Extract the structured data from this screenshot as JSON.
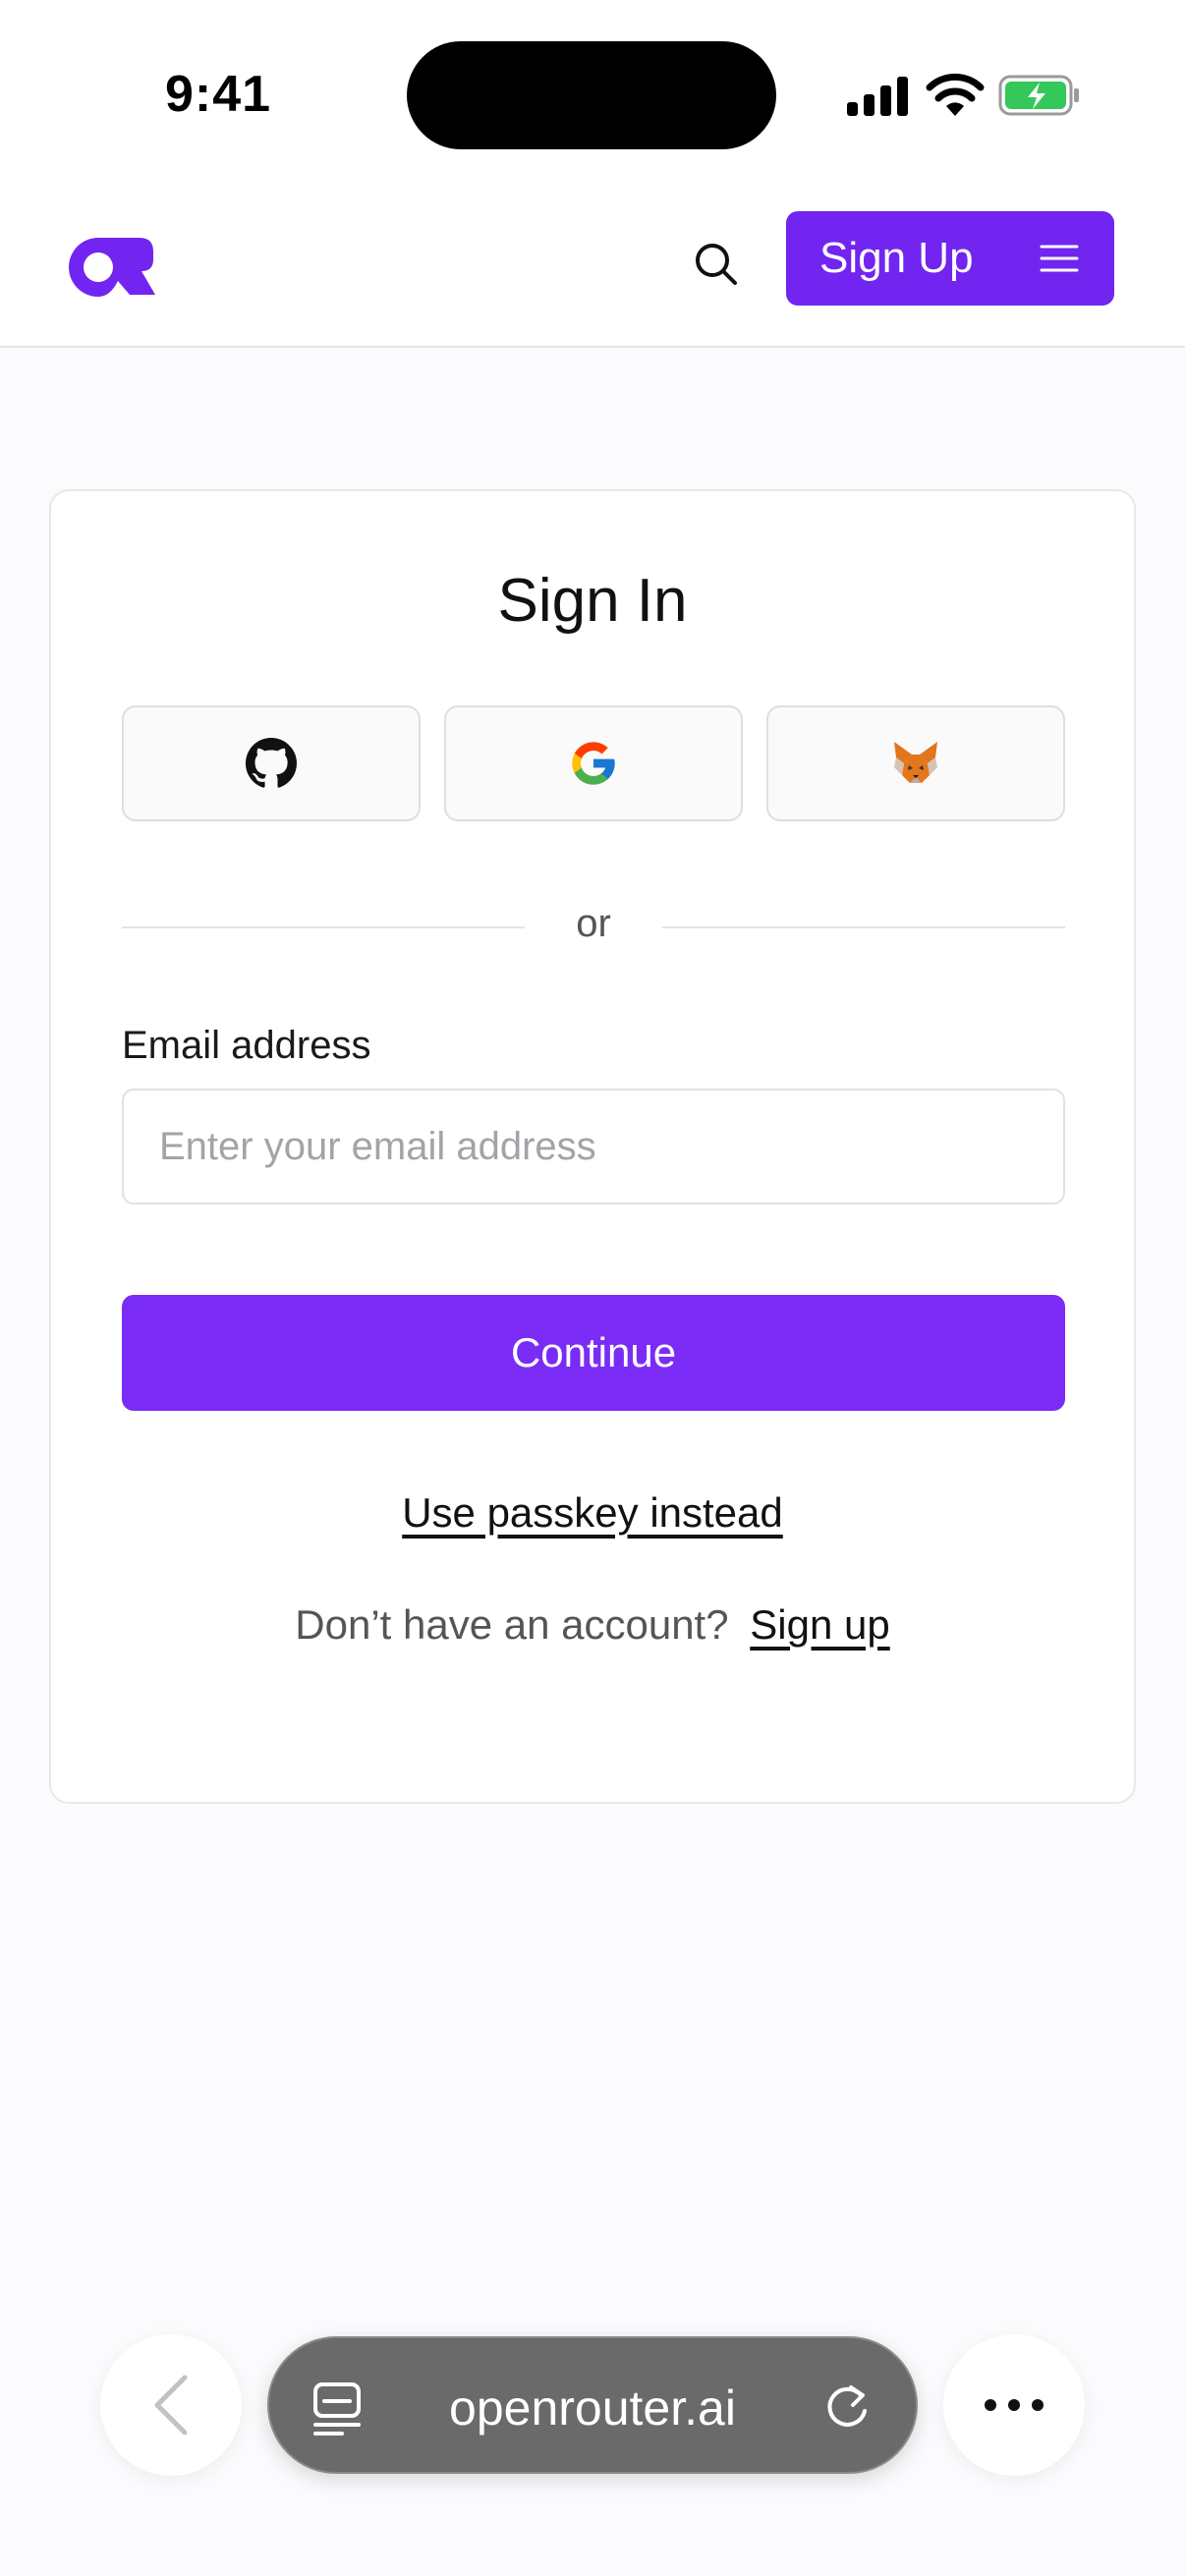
{
  "status_bar": {
    "time": "9:41",
    "icons": [
      "signal-icon",
      "wifi-icon",
      "battery-charging-icon"
    ]
  },
  "nav": {
    "logo_icon": "openrouter-logo-icon",
    "search_icon": "search-icon",
    "signup_label": "Sign Up",
    "menu_icon": "hamburger-menu-icon"
  },
  "signin": {
    "title": "Sign In",
    "oauth": [
      {
        "provider_icon": "github-icon"
      },
      {
        "provider_icon": "google-icon"
      },
      {
        "provider_icon": "metamask-icon"
      }
    ],
    "divider_text": "or",
    "email_label": "Email address",
    "email_placeholder": "Enter your email address",
    "email_value": "",
    "continue_label": "Continue",
    "passkey_label": "Use passkey instead",
    "no_account_text": "Don’t have an account?",
    "signup_link_label": "Sign up"
  },
  "browser": {
    "url": "openrouter.ai",
    "icons": [
      "back-chevron-icon",
      "tabs-icon",
      "reload-icon",
      "more-icon"
    ]
  },
  "colors": {
    "brand": "#7224f0",
    "button": "#7a2cf6",
    "background": "#fbfbfd"
  }
}
